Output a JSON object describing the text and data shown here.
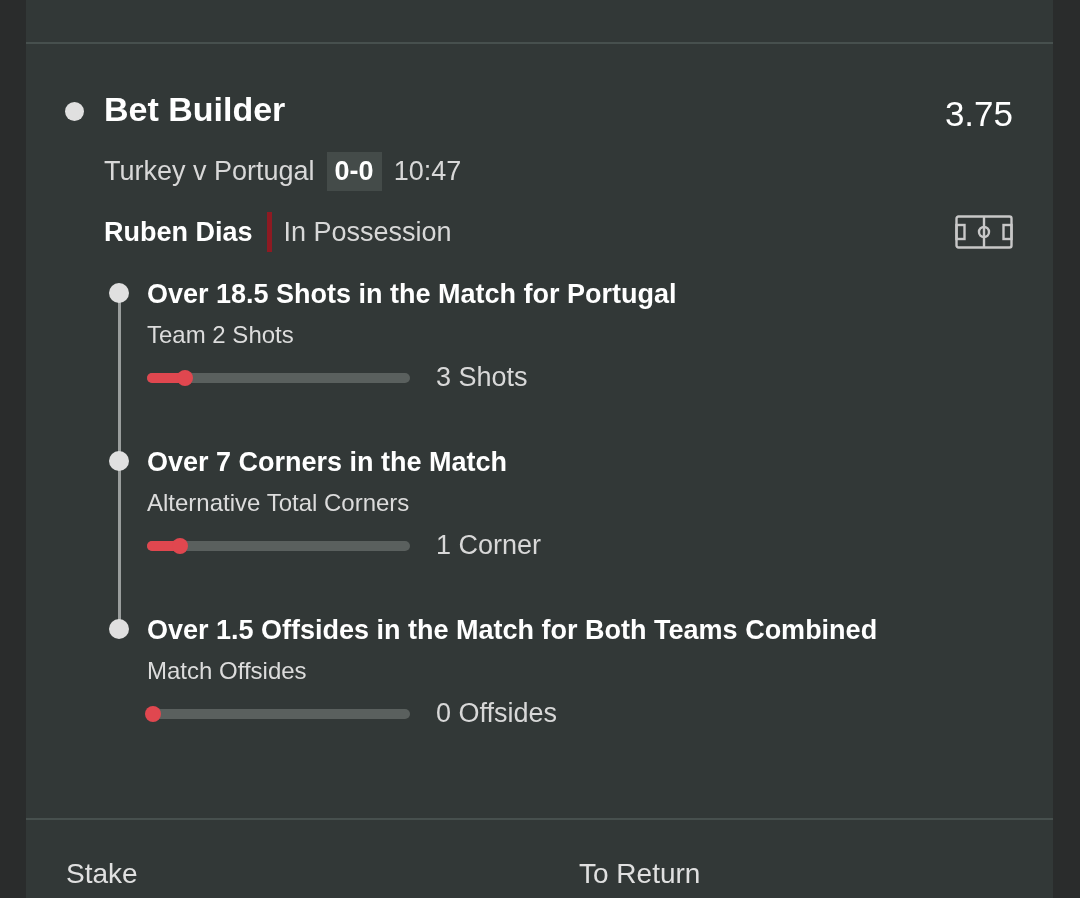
{
  "bet": {
    "title": "Bet Builder",
    "odds": "3.75",
    "match": "Turkey v Portugal",
    "score": "0-0",
    "clock": "10:47",
    "player": "Ruben Dias",
    "status": "In Possession"
  },
  "legs": [
    {
      "title": "Over 18.5 Shots in the Match for Portugal",
      "market": "Team 2 Shots",
      "level": 0.16,
      "reading": "3 Shots"
    },
    {
      "title": "Over 7 Corners in the Match",
      "market": "Alternative Total Corners",
      "level": 0.14,
      "reading": "1 Corner"
    },
    {
      "title": "Over 1.5 Offsides in the Match for Both Teams Combined",
      "market": "Match Offsides",
      "level": 0.03,
      "reading": "0 Offsides"
    }
  ],
  "footer": {
    "stake": "Stake",
    "to_return": "To Return"
  }
}
